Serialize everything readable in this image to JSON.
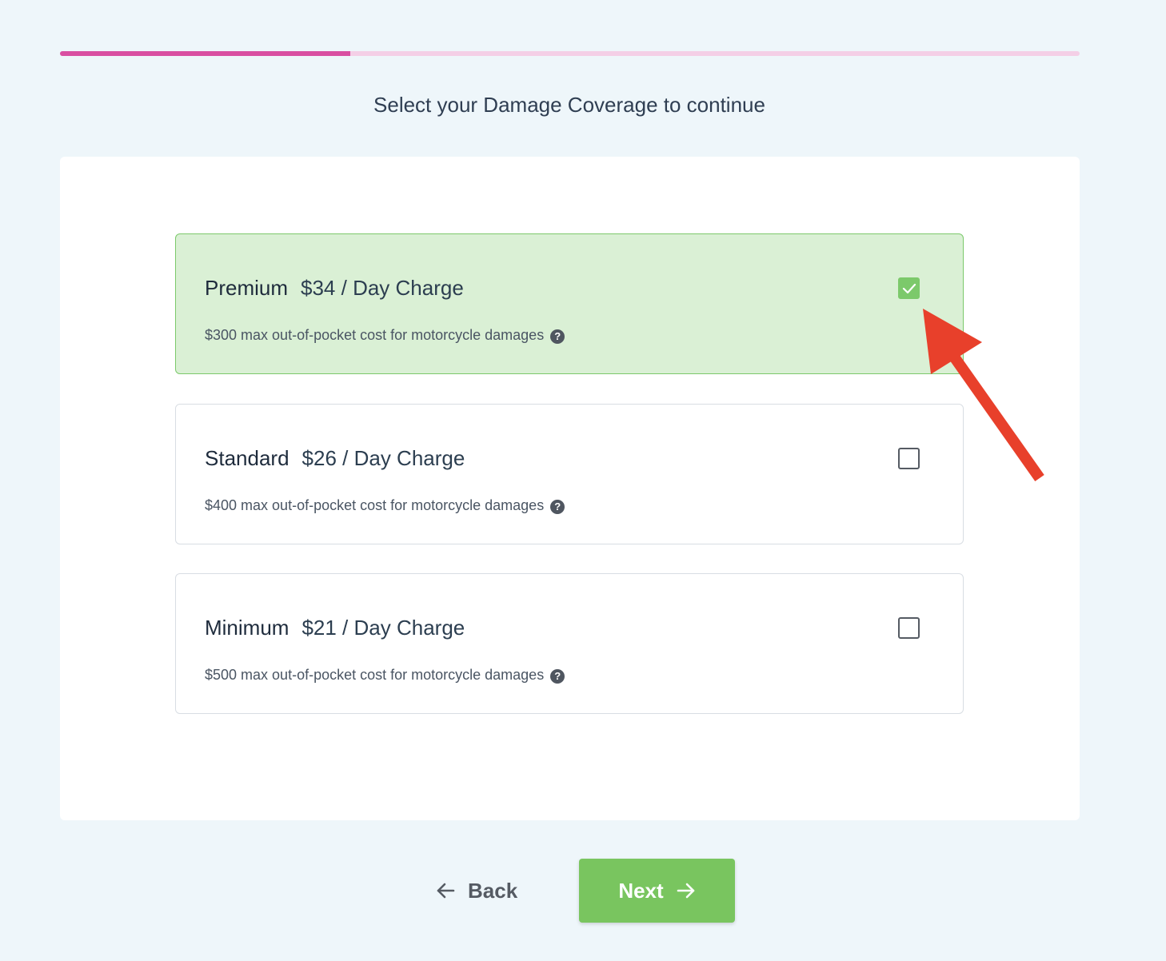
{
  "progress": {
    "fraction": 0.285
  },
  "page": {
    "title": "Select your Damage Coverage to continue"
  },
  "options": [
    {
      "name": "Premium",
      "price": "$34 / Day Charge",
      "description": "$300 max out-of-pocket cost for motorcycle damages",
      "selected": true
    },
    {
      "name": "Standard",
      "price": "$26 / Day Charge",
      "description": "$400 max out-of-pocket cost for motorcycle damages",
      "selected": false
    },
    {
      "name": "Minimum",
      "price": "$21 / Day Charge",
      "description": "$500 max out-of-pocket cost for motorcycle damages",
      "selected": false
    }
  ],
  "help_icon_glyph": "?",
  "nav": {
    "back_label": "Back",
    "next_label": "Next"
  },
  "icons": {
    "help": "question-circle-icon",
    "check": "checkmark-icon",
    "back": "arrow-left-icon",
    "next": "arrow-right-icon",
    "annotation": "red-arrow-icon"
  },
  "colors": {
    "accent_pink": "#d94fa1",
    "selected_green": "#7cc96b",
    "next_button": "#79c55f",
    "annotation_red": "#e8402b"
  }
}
